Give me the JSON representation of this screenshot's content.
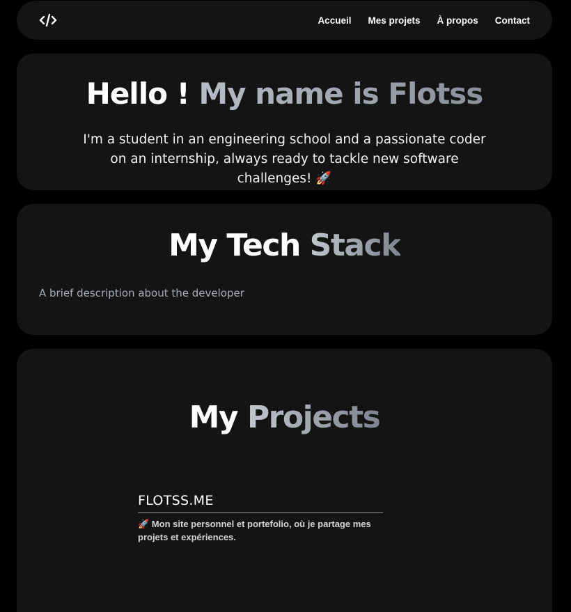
{
  "nav": {
    "logo_icon": "code-icon",
    "links": [
      {
        "label": "Accueil"
      },
      {
        "label": "Mes projets"
      },
      {
        "label": "À propos"
      },
      {
        "label": "Contact"
      }
    ]
  },
  "hero": {
    "title_white": "Hello ! ",
    "title_gradient": "My name is Flotss",
    "text": "I'm a student in an engineering school and a passionate coder on an internship, always ready to tackle new software challenges! 🚀"
  },
  "stack": {
    "title_white": "My Tech ",
    "title_gradient": "Stack",
    "description": "A brief description about the developer"
  },
  "projects": {
    "title_white": "My ",
    "title_gradient": "Projects",
    "items": [
      {
        "name": "FLOTSS.ME",
        "description": "🚀 Mon site personnel et portefolio, où je partage mes projets et expériences."
      }
    ]
  },
  "colors": {
    "background": "#000000",
    "card": "#141414",
    "gradient_start": "#b8bcc6",
    "gradient_end": "#7f8490",
    "muted_text": "#a9aeb8"
  }
}
